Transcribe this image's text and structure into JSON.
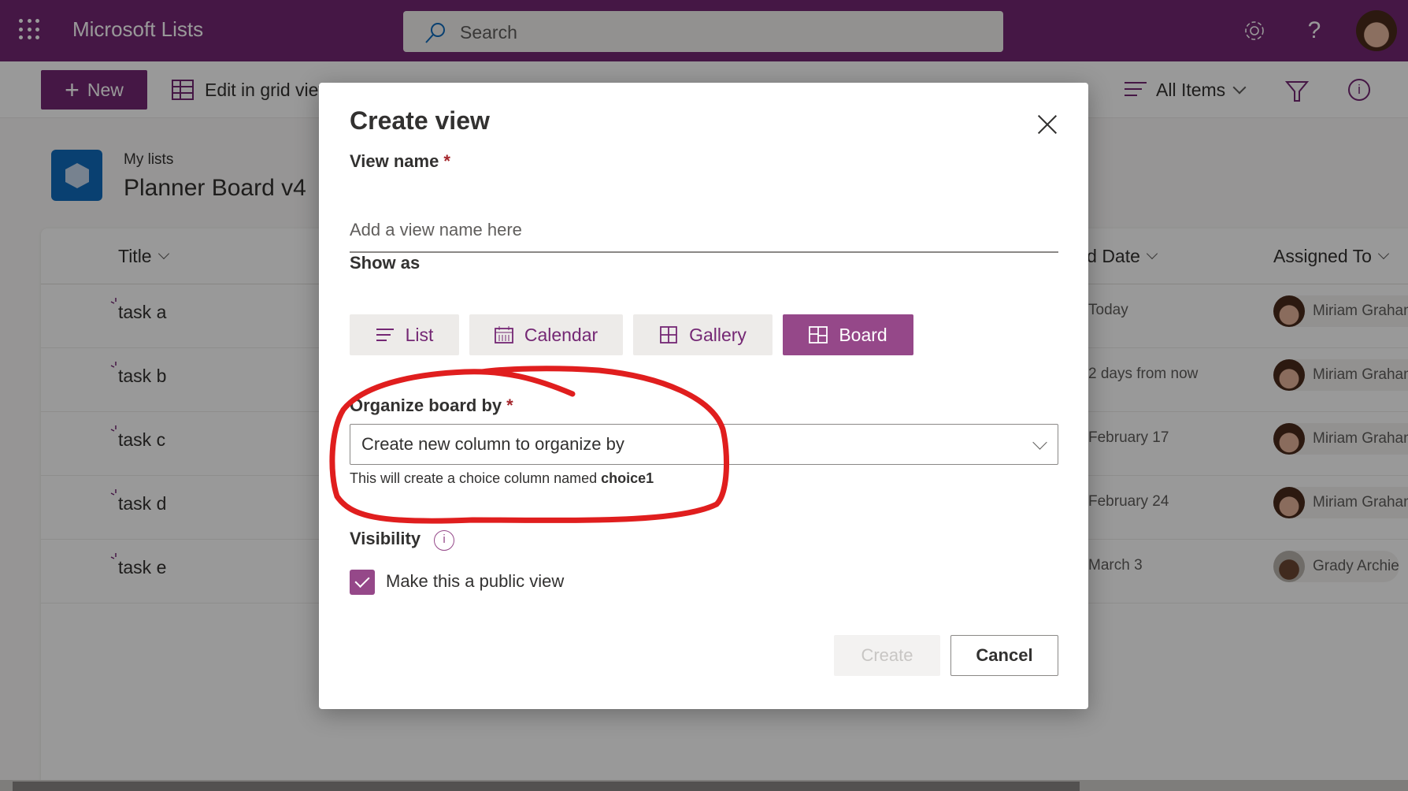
{
  "suite": {
    "app_title": "Microsoft Lists",
    "search_placeholder": "Search",
    "icons": [
      "waffle-icon",
      "search-icon",
      "gear-icon",
      "help-icon",
      "avatar"
    ],
    "help_glyph": "?"
  },
  "commandbar": {
    "new_label": "New",
    "new_glyph": "+",
    "edit_grid_label": "Edit in grid view",
    "view_selector_label": "All Items",
    "info_glyph": "i"
  },
  "list": {
    "breadcrumb": "My lists",
    "title": "Planner Board v4",
    "columns": {
      "title": "Title",
      "end_date": "End Date",
      "assigned_to": "Assigned To"
    },
    "rows": [
      {
        "title": "task a",
        "end_date": "Today",
        "assigned_to": "Miriam Graham"
      },
      {
        "title": "task b",
        "end_date": "2 days from now",
        "assigned_to": "Miriam Graham"
      },
      {
        "title": "task c",
        "end_date": "February 17",
        "assigned_to": "Miriam Graham"
      },
      {
        "title": "task d",
        "end_date": "February 24",
        "assigned_to": "Miriam Graham"
      },
      {
        "title": "task e",
        "end_date": "March 3",
        "assigned_to": "Grady Archie"
      }
    ]
  },
  "dialog": {
    "title": "Create view",
    "view_name_label": "View name",
    "required_mark": "*",
    "view_name_value": "",
    "view_name_placeholder": "Add a view name here",
    "show_as_label": "Show as",
    "show_as_options": [
      {
        "label": "List",
        "icon": "list-icon",
        "selected": false
      },
      {
        "label": "Calendar",
        "icon": "calendar-icon",
        "selected": false
      },
      {
        "label": "Gallery",
        "icon": "gallery-icon",
        "selected": false
      },
      {
        "label": "Board",
        "icon": "board-icon",
        "selected": true
      }
    ],
    "organize_label": "Organize board by",
    "organize_value": "Create new column to organize by",
    "hint_prefix": "This will create a choice column named",
    "hint_column": "choice1",
    "visibility_label": "Visibility",
    "visibility_info_glyph": "i",
    "public_view_label": "Make this a public view",
    "public_view_checked": true,
    "create_label": "Create",
    "create_disabled": true,
    "cancel_label": "Cancel"
  },
  "annotation": {
    "type": "hand-drawn-circle",
    "color": "#e01e1e",
    "target": "organize-board-by-field"
  },
  "colors": {
    "brand": "#742774",
    "accent_selected": "#954889",
    "required": "#a4262c"
  }
}
